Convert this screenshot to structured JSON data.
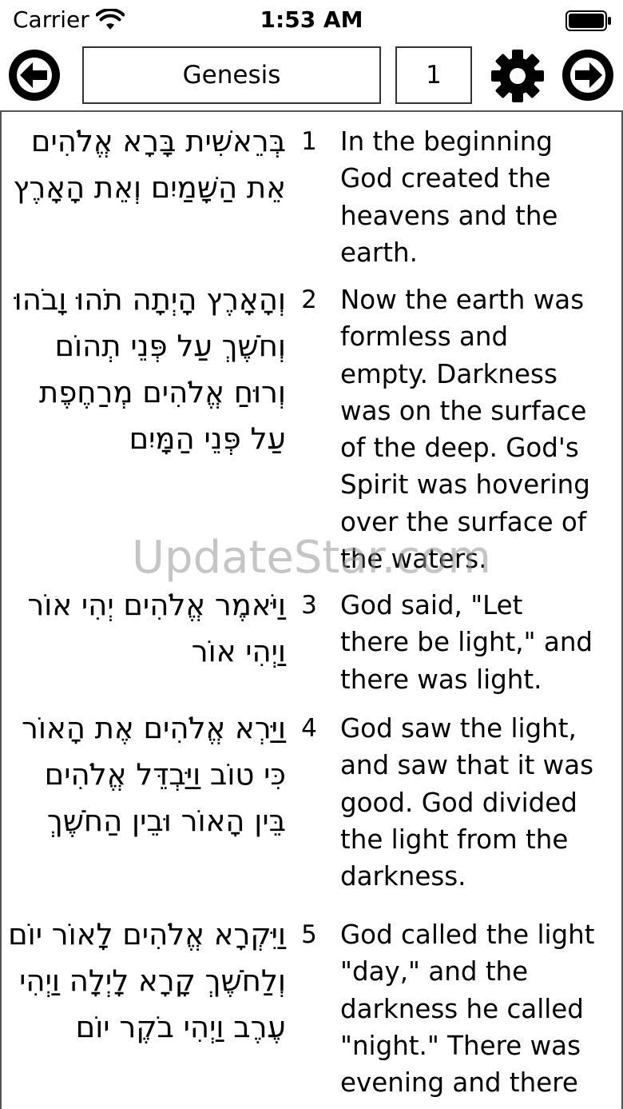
{
  "status_bar": {
    "carrier": "Carrier",
    "time": "1:53 AM"
  },
  "toolbar": {
    "book": "Genesis",
    "chapter": "1"
  },
  "verses": [
    {
      "number": "1",
      "hebrew": "בְּרֵאשִׁית בָּרָא אֱלֹהִים אֵת הַשָּׁמַיִם וְאֵת הָאָרֶץ",
      "english": "In the beginning\nGod created the\nheavens and the\nearth."
    },
    {
      "number": "2",
      "hebrew": "וְהָאָרֶץ הָיְתָה תֹהוּ וָבֹהוּ וְחֹשֶׁךְ עַל פְּנֵי תְהוֹם וְרוּחַ אֱלֹהִים מְרַחֶפֶת עַל פְּנֵי הַמָּיִם",
      "english": "Now the earth was\nformless and\nempty. Darkness\nwas on the surface\nof the deep. God's\nSpirit was hovering\nover the surface of\nthe waters."
    },
    {
      "number": "3",
      "hebrew": "וַיֹּאמֶר אֱלֹהִים יְהִי אוֹר וַיְהִי אוֹר",
      "english": "God said, \"Let\nthere be light,\" and\nthere was light."
    },
    {
      "number": "4",
      "hebrew": "וַיַּרְא אֱלֹהִים אֶת הָאוֹר כִּי טוֹב וַיַּבְדֵּל אֱלֹהִים בֵּין הָאוֹר וּבֵין הַחֹשֶׁךְ",
      "english": "God saw the light,\nand saw that it was\ngood. God divided\nthe light from the\ndarkness."
    },
    {
      "number": "5",
      "hebrew": "וַיִּקְרָא אֱלֹהִים לָאוֹר יוֹם וְלַחֹשֶׁךְ קָרָא לָיְלָה וַיְהִי עֶרֶב וַיְהִי בֹקֶר יוֹם",
      "english": "God called the light\n\"day,\" and the\ndarkness he called\n\"night.\" There was\nevening and there"
    }
  ],
  "watermark": "UpdateStar.com",
  "icons": {
    "back": "arrow-left-circle-icon",
    "forward": "arrow-right-circle-icon",
    "settings": "gear-icon",
    "wifi": "wifi-icon",
    "battery": "battery-icon"
  }
}
